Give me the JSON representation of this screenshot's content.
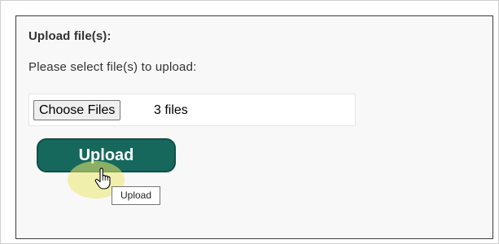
{
  "form": {
    "heading": "Upload file(s):",
    "prompt": "Please select file(s) to upload:",
    "file_input": {
      "button_label": "Choose Files",
      "status": "3 files"
    },
    "upload_button": {
      "label": "Upload",
      "color": "#17685c"
    },
    "tooltip": "Upload"
  },
  "cursor": {
    "icon": "hand-pointer-icon"
  }
}
